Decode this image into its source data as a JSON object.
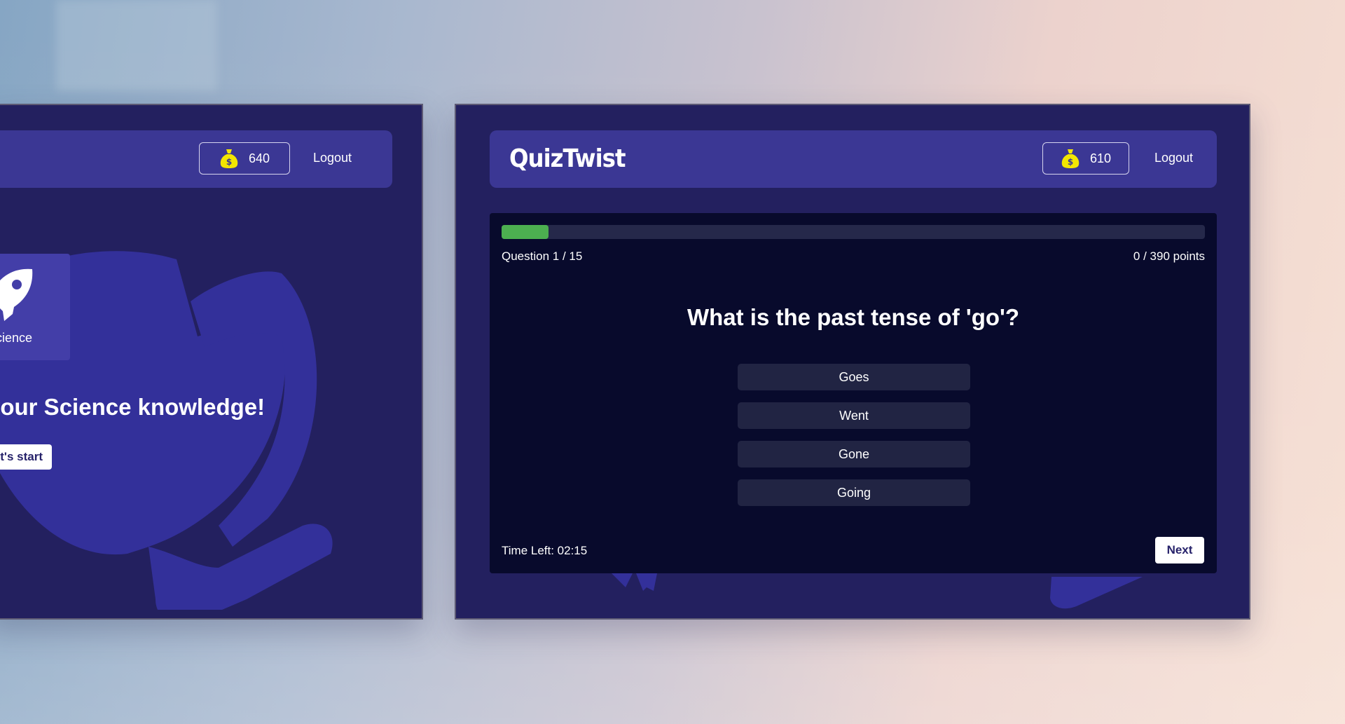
{
  "left_panel": {
    "coins": "640",
    "logout_label": "Logout",
    "category_label": "Science",
    "category_icon": "rocket-icon",
    "hero_title": "your Science knowledge!",
    "start_label": "et's start"
  },
  "right_panel": {
    "brand": "QuizTwist",
    "coins": "610",
    "logout_label": "Logout",
    "coin_icon": "money-bag-icon",
    "progress_fraction": 0.0667,
    "question_counter": "Question 1 / 15",
    "points": "0 / 390 points",
    "question": "What is the past tense of 'go'?",
    "answers": [
      "Goes",
      "Went",
      "Gone",
      "Going"
    ],
    "time_left": "Time Left: 02:15",
    "next_label": "Next"
  },
  "colors": {
    "panel_bg": "#23205f",
    "header_bg": "#3b3794",
    "quiz_bg": "#080a2c",
    "answer_bg": "#212443",
    "progress_fill": "#4caf50",
    "coin_yellow": "#f3e600"
  }
}
